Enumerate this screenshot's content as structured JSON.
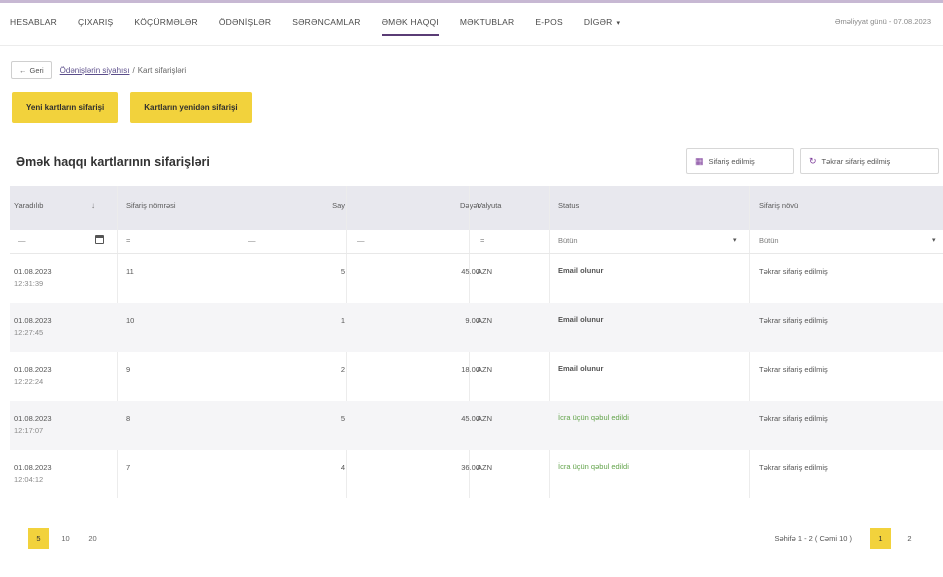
{
  "nav": {
    "items": [
      {
        "label": "HESABLAR"
      },
      {
        "label": "ÇIXARIŞ"
      },
      {
        "label": "KÖÇÜRMƏLƏR"
      },
      {
        "label": "ÖDƏNİŞLƏR"
      },
      {
        "label": "SƏRƏNCAMLAR"
      },
      {
        "label": "ƏMƏK HAQQI",
        "active": true
      },
      {
        "label": "MƏKTUBLAR"
      },
      {
        "label": "E-POS"
      },
      {
        "label": "DİGƏR",
        "dropdown": true
      }
    ],
    "today": "Əməliyyat günü - 07.08.2023"
  },
  "breadcrumb": {
    "back_label": "Geri",
    "link": "Ödənişlərin siyahısı",
    "separator": "/",
    "current": "Kart sifarişləri"
  },
  "actions": {
    "new_cards": "Yeni kartların sifarişi",
    "reorder_cards": "Kartların yenidən sifarişi"
  },
  "card": {
    "title": "Əmək haqqı kartlarının sifarişləri",
    "order_btn": "Sifariş edilmiş",
    "reorder_btn": "Təkrar sifariş edilmiş",
    "order_icon": "calendar-icon",
    "reorder_icon": "refresh-calendar-icon"
  },
  "table": {
    "headers": {
      "created": "Yaradılıb",
      "order_number": "Sifariş nömrəsi",
      "count": "Say",
      "amount": "Dəyər",
      "currency": "Valyuta",
      "status": "Status",
      "order_type": "Sifariş növü"
    },
    "filters": {
      "created": "—",
      "order_number_op": "=",
      "order_number": "—",
      "count": "—",
      "currency_op": "=",
      "status": "Bütün",
      "order_type": "Bütün"
    },
    "rows": [
      {
        "date": "01.08.2023",
        "time": "12:31:39",
        "number": "11",
        "count": "5",
        "amount": "45.00",
        "currency": "AZN",
        "status": "Email olunur",
        "status_ok": false,
        "type": "Təkrar sifariş edilmiş"
      },
      {
        "date": "01.08.2023",
        "time": "12:27:45",
        "number": "10",
        "count": "1",
        "amount": "9.00",
        "currency": "AZN",
        "status": "Email olunur",
        "status_ok": false,
        "type": "Təkrar sifariş edilmiş"
      },
      {
        "date": "01.08.2023",
        "time": "12:22:24",
        "number": "9",
        "count": "2",
        "amount": "18.00",
        "currency": "AZN",
        "status": "Email olunur",
        "status_ok": false,
        "type": "Təkrar sifariş edilmiş"
      },
      {
        "date": "01.08.2023",
        "time": "12:17:07",
        "number": "8",
        "count": "5",
        "amount": "45.00",
        "currency": "AZN",
        "status": "İcra üçün qəbul edildi",
        "status_ok": true,
        "type": "Təkrar sifariş edilmiş"
      },
      {
        "date": "01.08.2023",
        "time": "12:04:12",
        "number": "7",
        "count": "4",
        "amount": "36.00",
        "currency": "AZN",
        "status": "İcra üçün qəbul edildi",
        "status_ok": true,
        "type": "Təkrar sifariş edilmiş"
      }
    ]
  },
  "pagination": {
    "sizes": [
      "5",
      "10",
      "20"
    ],
    "active_size": "5",
    "info": "Səhifə 1 - 2 ( Cəmi 10 )",
    "pages": [
      "1",
      "2"
    ],
    "active_page": "1"
  },
  "colors": {
    "accent_yellow": "#f2d23c",
    "brand_purple": "#7b3a99",
    "status_green": "#63a44b"
  }
}
